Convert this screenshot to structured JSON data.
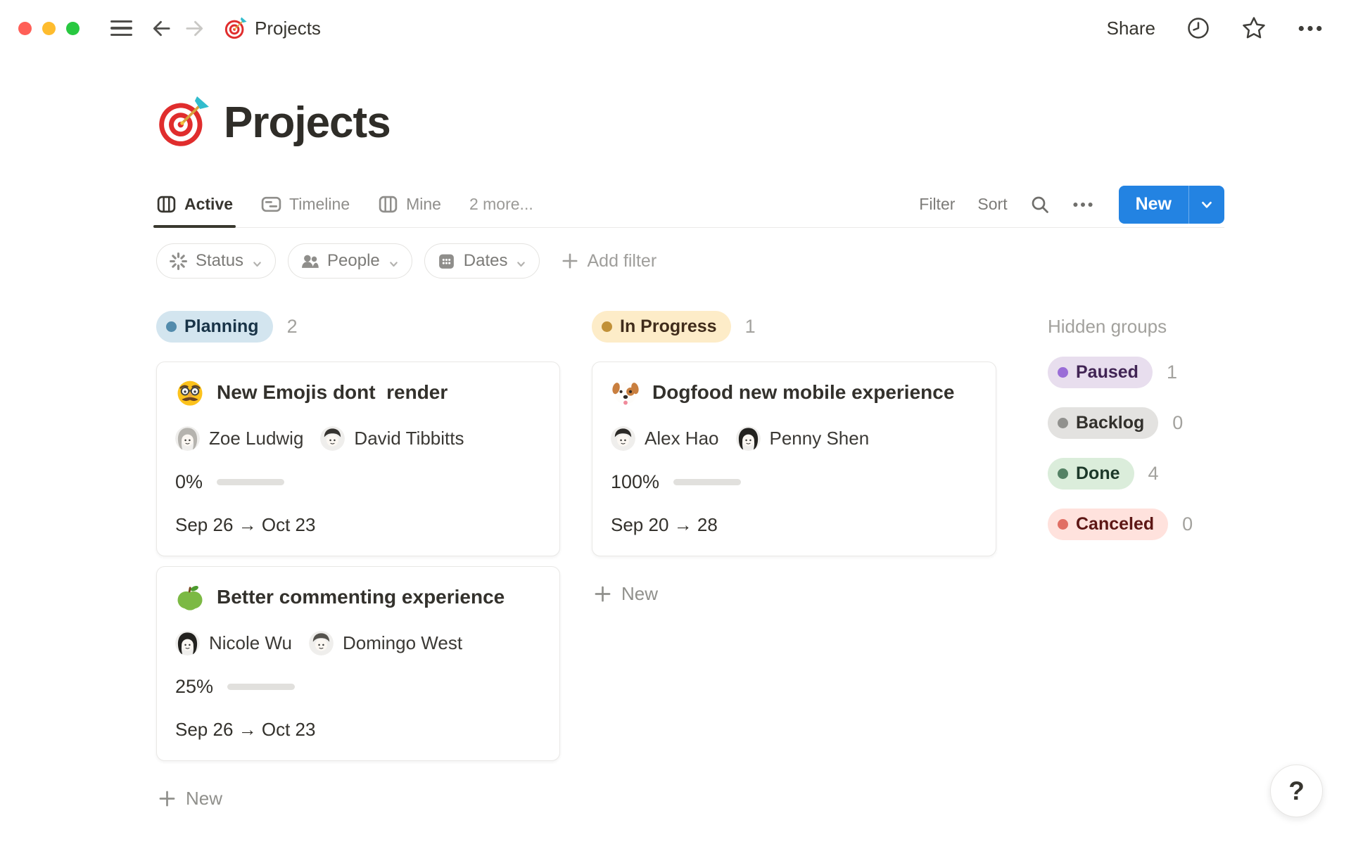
{
  "window": {
    "breadcrumb": "Projects",
    "share_label": "Share"
  },
  "page": {
    "title": "Projects",
    "emoji": "dart"
  },
  "tabs": [
    {
      "label": "Active"
    },
    {
      "label": "Timeline"
    },
    {
      "label": "Mine"
    },
    {
      "label": "2 more..."
    }
  ],
  "toolbar": {
    "filter_label": "Filter",
    "sort_label": "Sort",
    "new_label": "New"
  },
  "filters": [
    {
      "label": "Status"
    },
    {
      "label": "People"
    },
    {
      "label": "Dates"
    }
  ],
  "add_filter_label": "Add filter",
  "colors": {
    "accent": "#2383e2",
    "progress": "#6f9b7e"
  },
  "board": {
    "columns": [
      {
        "group": "Planning",
        "count": "2",
        "colors": {
          "bg": "#d3e5ef",
          "dot": "#528bac",
          "text": "#183347"
        },
        "new_label": "New",
        "cards": [
          {
            "emoji": "disguised-face",
            "title": "New Emojis dont  render",
            "people": [
              {
                "name": "Zoe Ludwig",
                "avatar": "woman-gray"
              },
              {
                "name": "David Tibbitts",
                "avatar": "man-glasses"
              }
            ],
            "progress": 0,
            "progress_label": "0%",
            "dates": "Sep 26 → Oct 23"
          },
          {
            "emoji": "green-apple",
            "title": "Better commenting experience",
            "people": [
              {
                "name": "Nicole Wu",
                "avatar": "woman-dark"
              },
              {
                "name": "Domingo West",
                "avatar": "man-bald"
              }
            ],
            "progress": 25,
            "progress_label": "25%",
            "dates": "Sep 26 → Oct 23"
          }
        ]
      },
      {
        "group": "In Progress",
        "count": "1",
        "colors": {
          "bg": "#fdecc8",
          "dot": "#c19138",
          "text": "#402c1b"
        },
        "new_label": "New",
        "cards": [
          {
            "emoji": "dog-face",
            "title": "Dogfood new mobile experience",
            "people": [
              {
                "name": "Alex Hao",
                "avatar": "man-dark"
              },
              {
                "name": "Penny Shen",
                "avatar": "woman-glasses"
              }
            ],
            "progress": 100,
            "progress_label": "100%",
            "dates": "Sep 20 → 28"
          }
        ]
      }
    ],
    "hidden": {
      "title": "Hidden groups",
      "groups": [
        {
          "label": "Paused",
          "count": "1",
          "colors": {
            "bg": "#e8deee",
            "dot": "#9a6dd7",
            "text": "#412454"
          }
        },
        {
          "label": "Backlog",
          "count": "0",
          "colors": {
            "bg": "#e3e2e0",
            "dot": "#91918e",
            "text": "#32302c"
          }
        },
        {
          "label": "Done",
          "count": "4",
          "colors": {
            "bg": "#dbeddb",
            "dot": "#548164",
            "text": "#1c3829"
          }
        },
        {
          "label": "Canceled",
          "count": "0",
          "colors": {
            "bg": "#ffe2dd",
            "dot": "#e16f64",
            "text": "#5d1715"
          }
        }
      ]
    }
  },
  "help_label": "?"
}
